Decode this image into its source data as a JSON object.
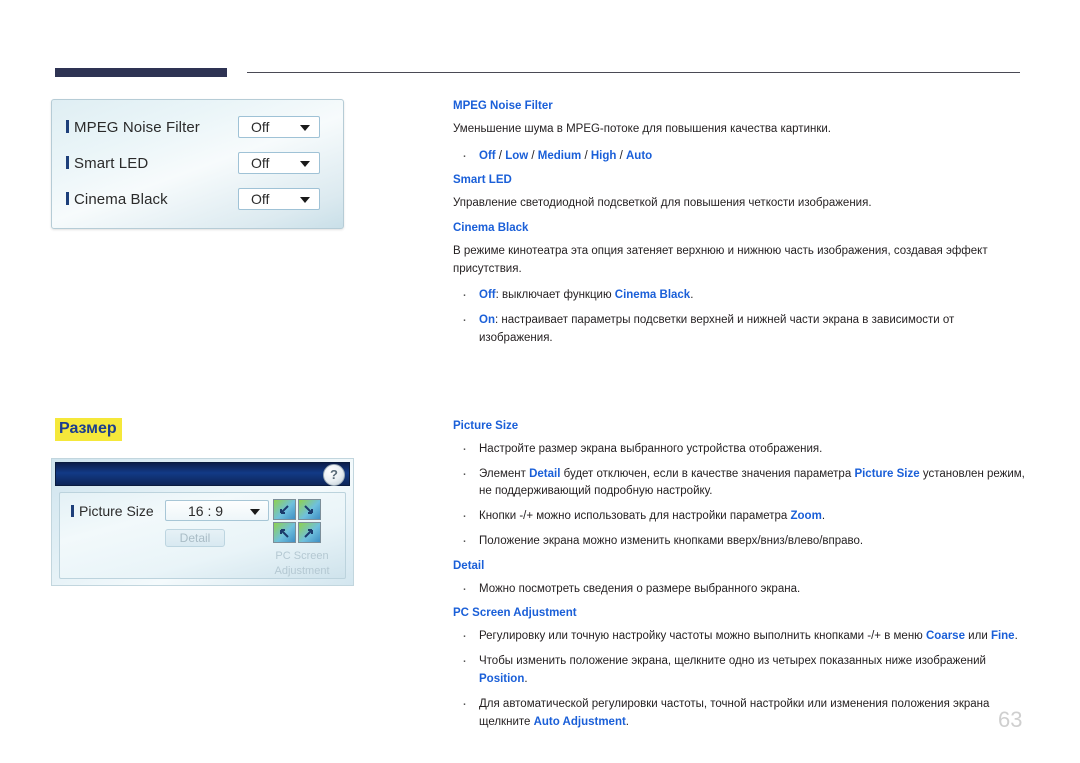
{
  "page": {
    "number": "63",
    "highlight_heading": "Размер",
    "accent_blue": "#1a5fd8",
    "highlight_yellow": "#f5e83a",
    "header_block_color": "#2e3353"
  },
  "osd_menu": {
    "rows": [
      {
        "label": "MPEG Noise Filter",
        "value": "Off"
      },
      {
        "label": "Smart LED",
        "value": "Off"
      },
      {
        "label": "Cinema Black",
        "value": "Off"
      }
    ]
  },
  "osd_picture_size": {
    "help_glyph": "?",
    "label": "Picture Size",
    "value": "16 : 9",
    "detail_button": "Detail",
    "pc_screen_adjustment": "PC Screen Adjustment"
  },
  "sections": [
    {
      "id": "mpeg-noise-filter",
      "heading": "MPEG Noise Filter",
      "paragraph": "Уменьшение шума в MPEG-потоке для повышения качества картинки.",
      "bullets": [
        {
          "parts": [
            {
              "t": "Off",
              "b": true
            },
            {
              "t": " / ",
              "b": false
            },
            {
              "t": "Low",
              "b": true
            },
            {
              "t": " / ",
              "b": false
            },
            {
              "t": "Medium",
              "b": true
            },
            {
              "t": " / ",
              "b": false
            },
            {
              "t": "High",
              "b": true
            },
            {
              "t": " / ",
              "b": false
            },
            {
              "t": "Auto",
              "b": true
            }
          ]
        }
      ]
    },
    {
      "id": "smart-led",
      "heading": "Smart LED",
      "paragraph": "Управление светодиодной подсветкой для повышения четкости изображения.",
      "bullets": []
    },
    {
      "id": "cinema-black",
      "heading": "Cinema Black",
      "paragraph": "В режиме кинотеатра эта опция затеняет верхнюю и нижнюю часть изображения, создавая эффект присутствия.",
      "bullets": [
        {
          "parts": [
            {
              "t": "Off",
              "b": true
            },
            {
              "t": ": выключает функцию ",
              "b": false
            },
            {
              "t": "Cinema Black",
              "b": true
            },
            {
              "t": ".",
              "b": false
            }
          ]
        },
        {
          "parts": [
            {
              "t": "On",
              "b": true
            },
            {
              "t": ": настраивает параметры подсветки верхней и нижней части экрана в зависимости от изображения.",
              "b": false
            }
          ]
        }
      ]
    },
    {
      "id": "picture-size",
      "heading": "Picture Size",
      "paragraph": "",
      "bullets": [
        {
          "parts": [
            {
              "t": "Настройте размер экрана выбранного устройства отображения.",
              "b": false
            }
          ]
        },
        {
          "parts": [
            {
              "t": "Элемент ",
              "b": false
            },
            {
              "t": "Detail",
              "b": true
            },
            {
              "t": " будет отключен, если в качестве значения параметра ",
              "b": false
            },
            {
              "t": "Picture Size",
              "b": true
            },
            {
              "t": " установлен режим, не поддерживающий подробную настройку.",
              "b": false
            }
          ]
        },
        {
          "parts": [
            {
              "t": "Кнопки -/+ можно использовать для настройки параметра ",
              "b": false
            },
            {
              "t": "Zoom",
              "b": true
            },
            {
              "t": ".",
              "b": false
            }
          ]
        },
        {
          "parts": [
            {
              "t": "Положение экрана можно изменить кнопками вверх/вниз/влево/вправо.",
              "b": false
            }
          ]
        }
      ]
    },
    {
      "id": "detail",
      "heading": "Detail",
      "paragraph": "",
      "bullets": [
        {
          "parts": [
            {
              "t": "Можно посмотреть сведения о размере выбранного экрана.",
              "b": false
            }
          ]
        }
      ]
    },
    {
      "id": "pc-screen-adjustment",
      "heading": "PC Screen Adjustment",
      "paragraph": "",
      "bullets": [
        {
          "parts": [
            {
              "t": "Регулировку или точную настройку частоты можно выполнить кнопками -/+ в меню ",
              "b": false
            },
            {
              "t": "Coarse",
              "b": true
            },
            {
              "t": " или ",
              "b": false
            },
            {
              "t": "Fine",
              "b": true
            },
            {
              "t": ".",
              "b": false
            }
          ]
        },
        {
          "parts": [
            {
              "t": "Чтобы изменить положение экрана, щелкните одно из четырех показанных ниже изображений ",
              "b": false
            },
            {
              "t": "Position",
              "b": true
            },
            {
              "t": ".",
              "b": false
            }
          ]
        },
        {
          "parts": [
            {
              "t": "Для автоматической регулировки частоты, точной настройки или изменения положения экрана щелкните ",
              "b": false
            },
            {
              "t": "Auto Adjustment",
              "b": true
            },
            {
              "t": ".",
              "b": false
            }
          ]
        }
      ]
    }
  ]
}
